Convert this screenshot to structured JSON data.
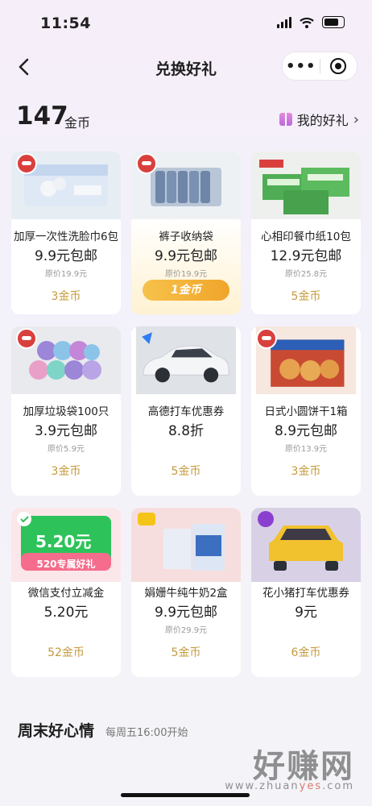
{
  "status": {
    "time": "11:54"
  },
  "nav": {
    "title": "兑换好礼",
    "more": "•••"
  },
  "coins": {
    "amount": "147",
    "unit": "金币"
  },
  "my_gifts": {
    "label": "我的好礼",
    "arrow": "›"
  },
  "items": [
    {
      "name": "加厚一次性洗脸巾6包",
      "price": "9.9元包邮",
      "orig": "原价19.9元",
      "cost": "3金币"
    },
    {
      "name": "裤子收纳袋",
      "price": "9.9元包邮",
      "orig": "原价19.9元",
      "cost": "1金币"
    },
    {
      "name": "心相印餐巾纸10包",
      "price": "12.9元包邮",
      "orig": "原价25.8元",
      "cost": "5金币"
    },
    {
      "name": "加厚垃圾袋100只",
      "price": "3.9元包邮",
      "orig": "原价5.9元",
      "cost": "3金币"
    },
    {
      "name": "高德打车优惠券",
      "price": "8.8折",
      "orig": "",
      "cost": "5金币"
    },
    {
      "name": "日式小圆饼干1箱",
      "price": "8.9元包邮",
      "orig": "原价13.9元",
      "cost": "3金币"
    },
    {
      "name": "微信支付立减金",
      "price": "5.20元",
      "orig": "",
      "cost": "52金币",
      "img_amount": "5.20元",
      "img_banner": "520专属好礼"
    },
    {
      "name": "娟姗牛纯牛奶2盒",
      "price": "9.9元包邮",
      "orig": "原价29.9元",
      "cost": "5金币"
    },
    {
      "name": "花小猪打车优惠券",
      "price": "9元",
      "orig": "",
      "cost": "6金币"
    }
  ],
  "section": {
    "title": "周末好心情",
    "subtitle": "每周五16:00开始"
  },
  "watermark": {
    "big": "好赚网",
    "small_a": "www.zhuan",
    "small_b": "yes",
    "small_c": ".com"
  },
  "colors": {
    "coin": "#c69a3c",
    "accent_btn": "#f0a52a",
    "badge": "#d9403d"
  }
}
